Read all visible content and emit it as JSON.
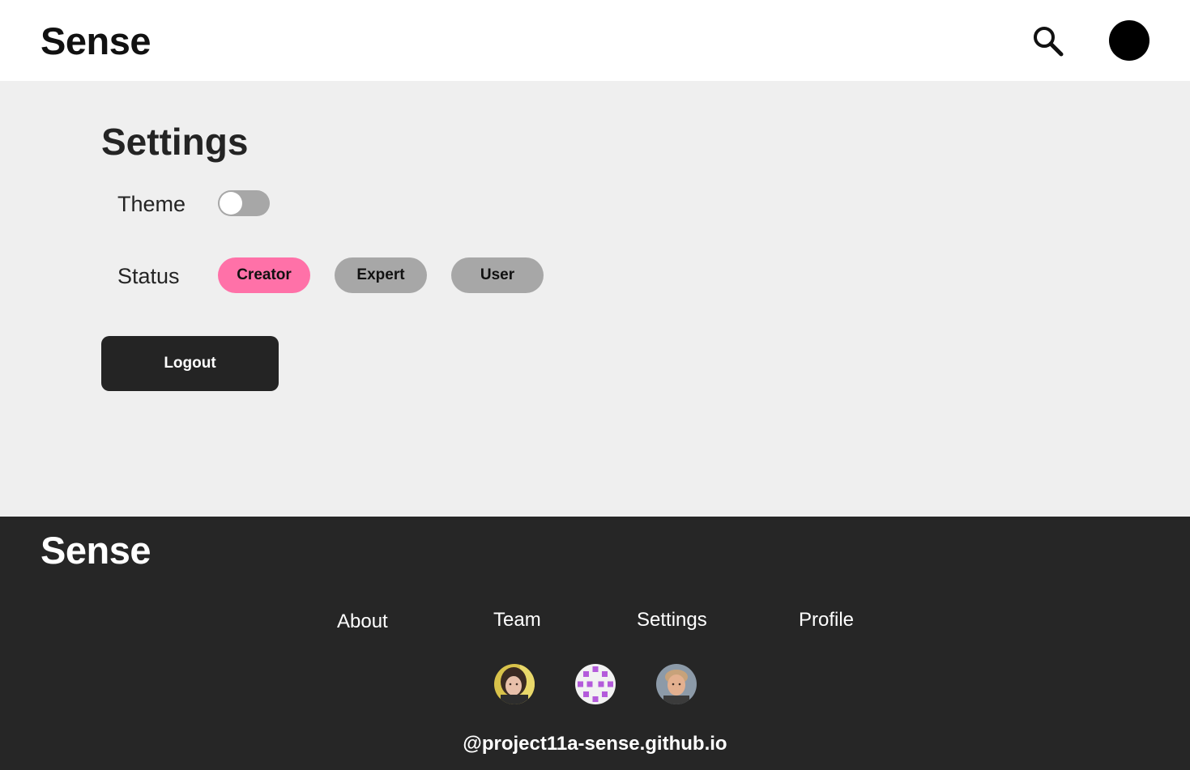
{
  "header": {
    "brand": "Sense",
    "search_icon": "search-icon",
    "avatar_icon": "user-avatar"
  },
  "settings": {
    "title": "Settings",
    "theme": {
      "label": "Theme",
      "enabled": false
    },
    "status": {
      "label": "Status",
      "options": [
        "Creator",
        "Expert",
        "User"
      ],
      "selected": "Creator"
    },
    "logout_label": "Logout"
  },
  "footer": {
    "brand": "Sense",
    "links": [
      "About",
      "Team",
      "Settings",
      "Profile"
    ],
    "team_avatars": [
      "team-member-photo",
      "team-member-pattern",
      "team-member-photo"
    ],
    "url": "@project11a-sense.github.io"
  },
  "colors": {
    "header_bg": "#ffffff",
    "main_bg": "#efefef",
    "footer_bg": "#262626",
    "accent_selected": "#ff71a8",
    "pill_inactive": "#a7a7a7",
    "button_dark": "#242424",
    "toggle_off": "#a7a7a7",
    "avatar_pattern_purple": "#b45bdb"
  }
}
